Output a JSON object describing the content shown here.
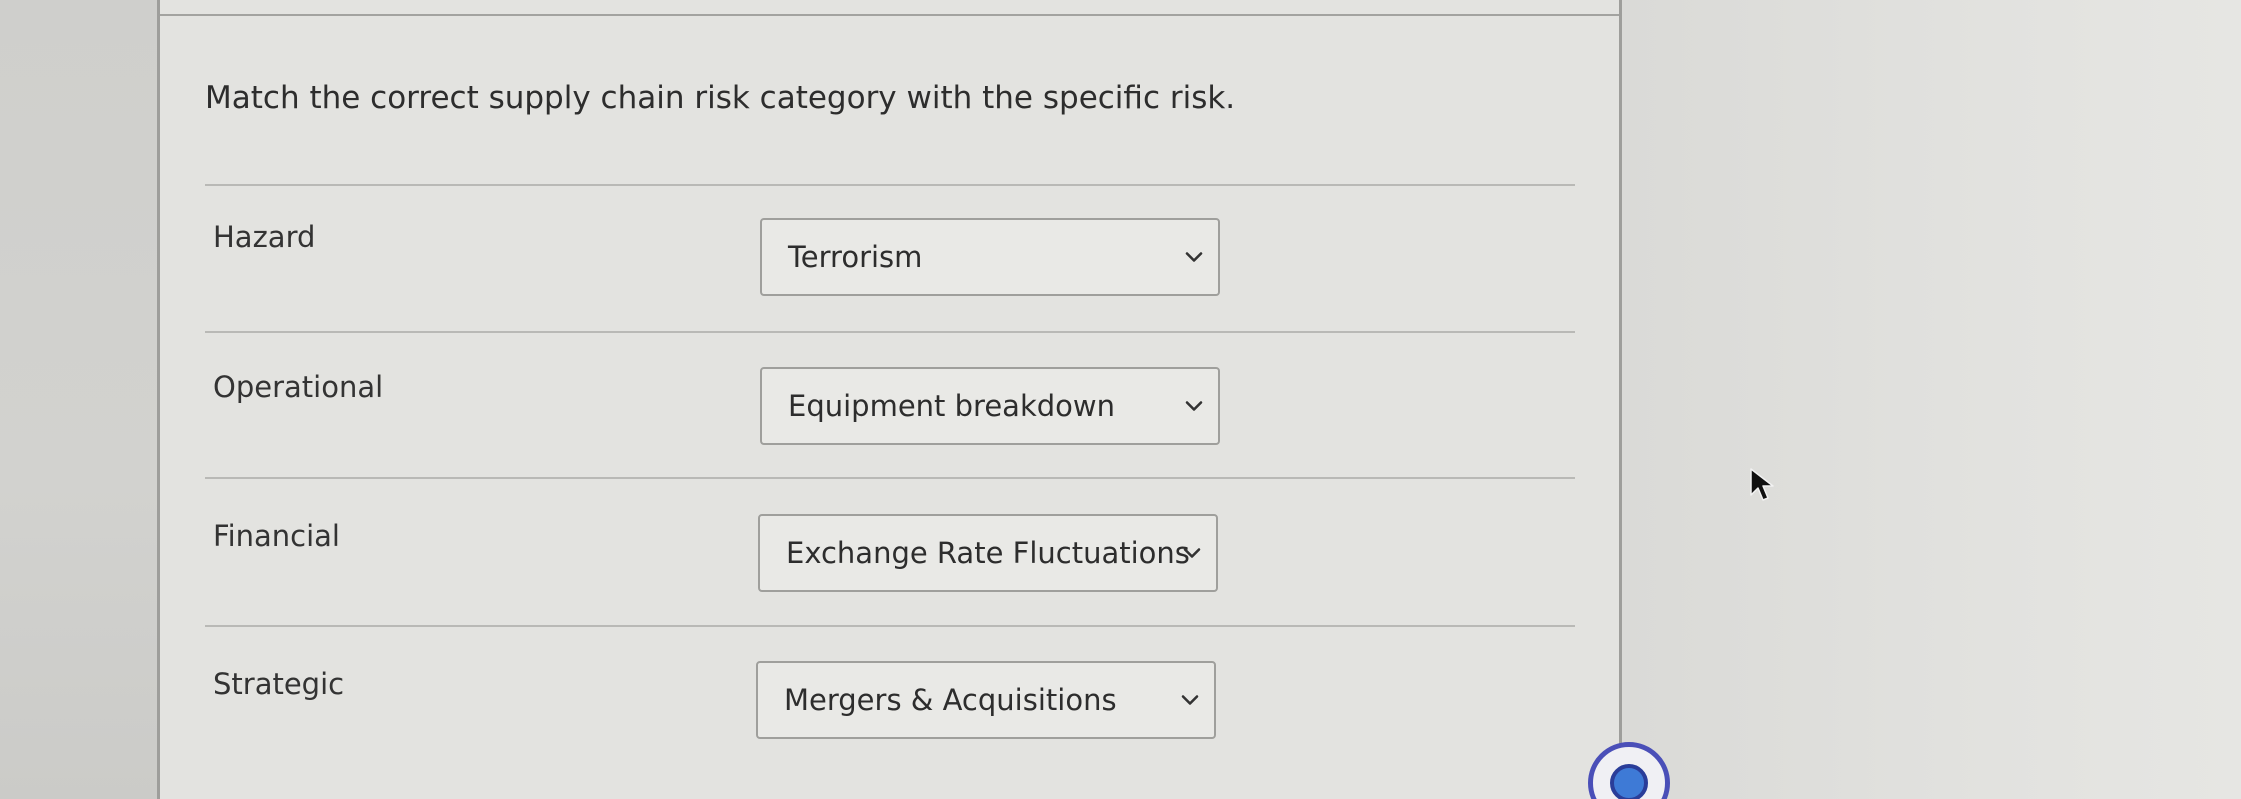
{
  "question": {
    "text": "Match the correct supply chain risk category with the specific risk."
  },
  "rows": [
    {
      "label": "Hazard",
      "selected": "Terrorism"
    },
    {
      "label": "Operational",
      "selected": "Equipment breakdown"
    },
    {
      "label": "Financial",
      "selected": "Exchange Rate Fluctuations"
    },
    {
      "label": "Strategic",
      "selected": "Mergers & Acquisitions"
    }
  ],
  "icons": {
    "dropdown": "chevron-down-icon",
    "cursor": "mouse-cursor-icon",
    "assistant": "assistant-bubble-icon"
  },
  "colors": {
    "panel_bg": "#e3e3e0",
    "text": "#2d2d2d",
    "border": "#9f9f9c",
    "accent": "#4a4fb8"
  }
}
